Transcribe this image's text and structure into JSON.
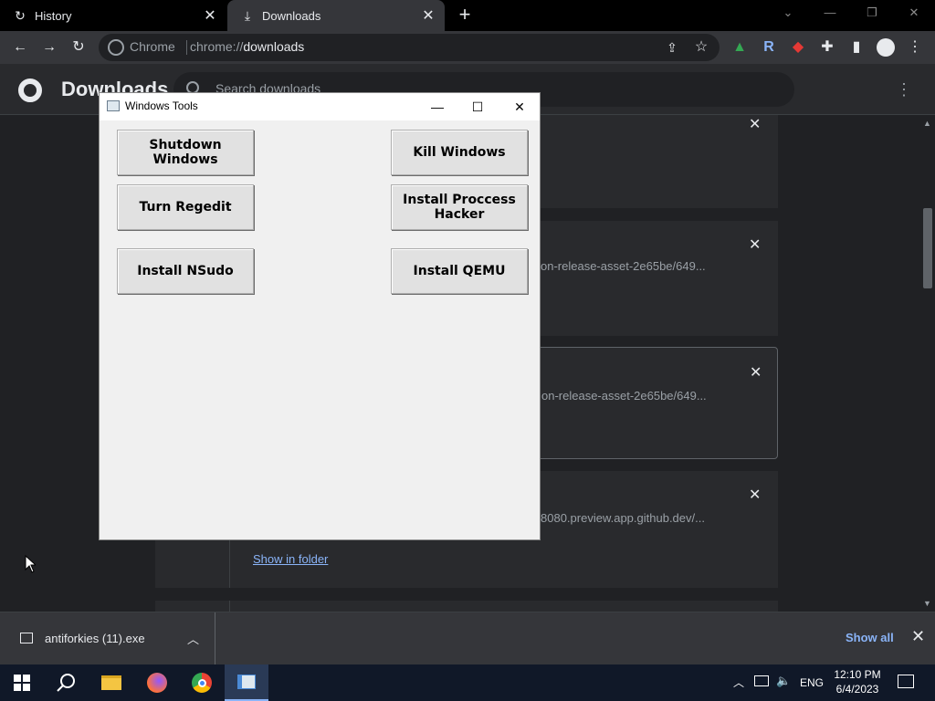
{
  "tabs": [
    {
      "title": "History",
      "icon": "history-icon"
    },
    {
      "title": "Downloads",
      "icon": "download-icon"
    }
  ],
  "toolbar": {
    "omnibox_chip": "Chrome",
    "url_scheme": "chrome://",
    "url_host": "downloads"
  },
  "downloads_page": {
    "title": "Downloads",
    "search_placeholder": "Search downloads",
    "items": [
      {
        "url": ""
      },
      {
        "url": "on-release-asset-2e65be/649..."
      },
      {
        "url": "on-release-asset-2e65be/649..."
      },
      {
        "url": "8080.preview.app.github.dev/..."
      }
    ],
    "show_in_folder": "Show in folder"
  },
  "shelf": {
    "file_name": "antiforkies (11).exe",
    "show_all": "Show all"
  },
  "dialog": {
    "title": "Windows Tools",
    "buttons": [
      {
        "label": "Shutdown Windows"
      },
      {
        "label": "Kill Windows"
      },
      {
        "label": "Turn Regedit"
      },
      {
        "label": "Install Proccess Hacker"
      },
      {
        "label": "Install NSudo"
      },
      {
        "label": "Install QEMU"
      }
    ]
  },
  "taskbar": {
    "language": "ENG",
    "time": "12:10 PM",
    "date": "6/4/2023"
  },
  "colors": {
    "link": "#8ab4f8",
    "page_bg": "#202124",
    "dialog_bg": "#f0f0f0"
  }
}
